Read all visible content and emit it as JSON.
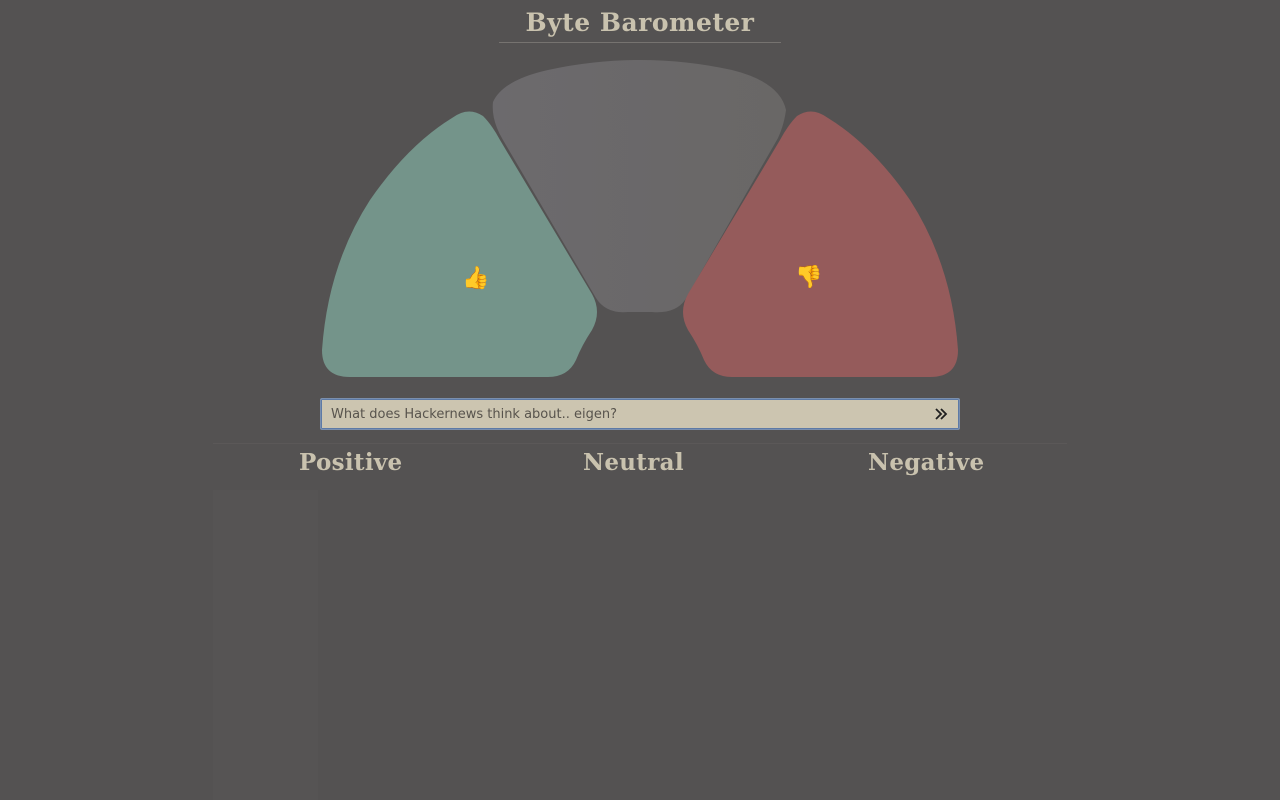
{
  "app": {
    "title": "Byte Barometer"
  },
  "gauge": {
    "positive_icon": "thumbs-up-icon",
    "neutral_icon": "none",
    "negative_icon": "thumbs-down-icon",
    "positive_glyph": "👍",
    "negative_glyph": "👎",
    "colors": {
      "positive": "#74948a",
      "neutral": "#6a6867",
      "negative": "#955b5b"
    }
  },
  "search": {
    "placeholder": "What does Hackernews think about.. eigen?",
    "value": "",
    "submit_icon": "double-chevron-right-icon"
  },
  "columns": {
    "positive": "Positive",
    "neutral": "Neutral",
    "negative": "Negative"
  }
}
